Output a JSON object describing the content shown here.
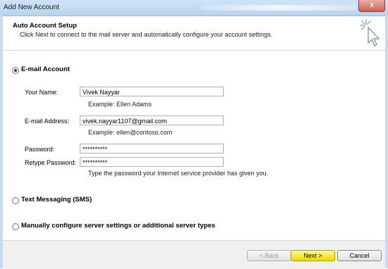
{
  "window": {
    "title": "Add New Account",
    "close_glyph": "x"
  },
  "header": {
    "title": "Auto Account Setup",
    "description": "Click Next to connect to the mail server and automatically configure your account settings.",
    "icon": "cursor-sparkle-icon"
  },
  "options": {
    "email_account_label": "E-mail Account",
    "email_account_selected": true,
    "text_messaging_label": "Text Messaging (SMS)",
    "text_messaging_selected": false,
    "manual_label": "Manually configure server settings or additional server types",
    "manual_selected": false
  },
  "form": {
    "your_name_label": "Your Name:",
    "your_name_value": "Vivek Nayyar",
    "your_name_example": "Example: Ellen Adams",
    "email_label": "E-mail Address:",
    "email_value": "vivek.nayyar1107@gmail.com",
    "email_example": "Example: ellen@contoso.com",
    "password_label": "Password:",
    "password_value": "**********",
    "retype_password_label": "Retype Password:",
    "retype_password_value": "**********",
    "password_hint": "Type the password your Internet service provider has given you."
  },
  "buttons": {
    "back_label": "< Back",
    "next_label": "Next >",
    "cancel_label": "Cancel"
  }
}
